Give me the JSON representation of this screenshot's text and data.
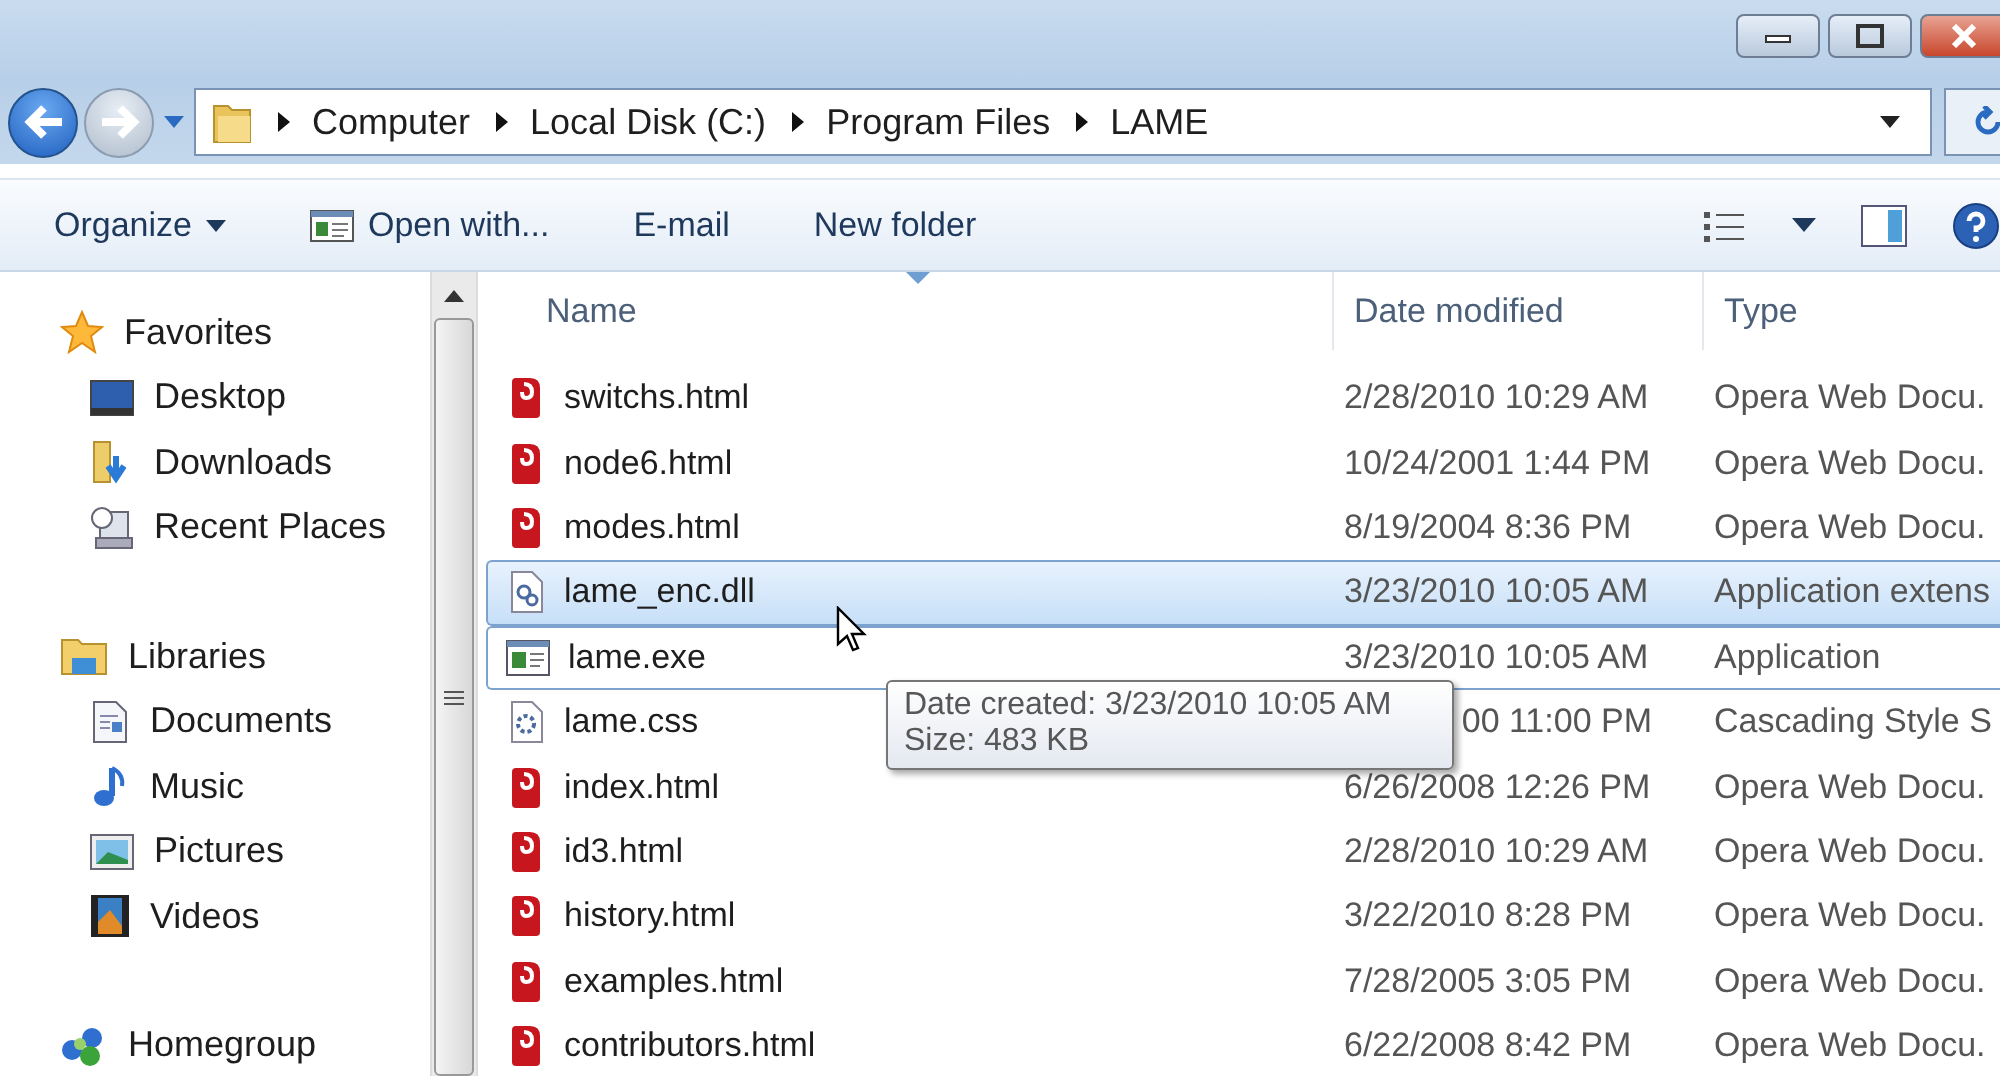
{
  "address": {
    "breadcrumbs": [
      "Computer",
      "Local Disk (C:)",
      "Program Files",
      "LAME"
    ]
  },
  "toolbar": {
    "items": [
      {
        "label": "Organize",
        "kind": "menu"
      },
      {
        "label": "Open with...",
        "kind": "icon_button"
      },
      {
        "label": "E-mail",
        "kind": "button"
      },
      {
        "label": "New folder",
        "kind": "button"
      }
    ]
  },
  "sidebar": {
    "groups": [
      {
        "label": "Favorites",
        "kind": "favorites",
        "items": [
          {
            "label": "Desktop",
            "kind": "desktop"
          },
          {
            "label": "Downloads",
            "kind": "downloads"
          },
          {
            "label": "Recent Places",
            "kind": "recent"
          }
        ]
      },
      {
        "label": "Libraries",
        "kind": "libraries",
        "items": [
          {
            "label": "Documents",
            "kind": "documents"
          },
          {
            "label": "Music",
            "kind": "music"
          },
          {
            "label": "Pictures",
            "kind": "pictures"
          },
          {
            "label": "Videos",
            "kind": "videos"
          }
        ]
      },
      {
        "label": "Homegroup",
        "kind": "homegroup"
      }
    ]
  },
  "table": {
    "columns": [
      {
        "label": "Name",
        "sorted": true
      },
      {
        "label": "Date modified"
      },
      {
        "label": "Type"
      }
    ],
    "rows": [
      {
        "name": "switchs.html",
        "date": "2/28/2010 10:29 AM",
        "type": "Opera Web Docu.",
        "kind": "html",
        "selected": false,
        "focused": false
      },
      {
        "name": "node6.html",
        "date": "10/24/2001 1:44 PM",
        "type": "Opera Web Docu.",
        "kind": "html",
        "selected": false,
        "focused": false
      },
      {
        "name": "modes.html",
        "date": "8/19/2004 8:36 PM",
        "type": "Opera Web Docu.",
        "kind": "html",
        "selected": false,
        "focused": false
      },
      {
        "name": "lame_enc.dll",
        "date": "3/23/2010 10:05 AM",
        "type": "Application extens",
        "kind": "dll",
        "selected": true,
        "focused": false
      },
      {
        "name": "lame.exe",
        "date": "3/23/2010 10:05 AM",
        "type": "Application",
        "kind": "exe",
        "selected": false,
        "focused": true
      },
      {
        "name": "lame.css",
        "date": "00 11:00 PM",
        "type": "Cascading Style S",
        "kind": "css",
        "selected": false,
        "focused": false,
        "date_cut_left": true
      },
      {
        "name": "index.html",
        "date": "6/26/2008 12:26 PM",
        "type": "Opera Web Docu.",
        "kind": "html",
        "selected": false,
        "focused": false
      },
      {
        "name": "id3.html",
        "date": "2/28/2010 10:29 AM",
        "type": "Opera Web Docu.",
        "kind": "html",
        "selected": false,
        "focused": false
      },
      {
        "name": "history.html",
        "date": "3/22/2010 8:28 PM",
        "type": "Opera Web Docu.",
        "kind": "html",
        "selected": false,
        "focused": false
      },
      {
        "name": "examples.html",
        "date": "7/28/2005 3:05 PM",
        "type": "Opera Web Docu.",
        "kind": "html",
        "selected": false,
        "focused": false
      },
      {
        "name": "contributors.html",
        "date": "6/22/2008 8:42 PM",
        "type": "Opera Web Docu.",
        "kind": "html",
        "selected": false,
        "focused": false
      }
    ]
  },
  "tooltip": {
    "lines": [
      "Date created: 3/23/2010 10:05 AM",
      "Size: 483 KB"
    ]
  }
}
